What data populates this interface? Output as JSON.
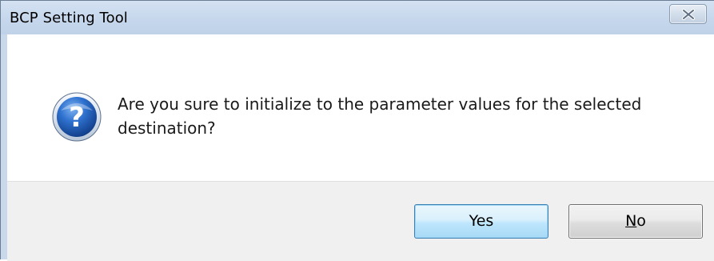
{
  "window": {
    "title": "BCP Setting Tool"
  },
  "titlebar": {
    "close_icon": "close-icon"
  },
  "dialog": {
    "icon": "question-icon",
    "message": "Are you sure to initialize to the parameter values for the selected destination?"
  },
  "buttons": {
    "yes_label": "Yes",
    "no_mnemonic": "N",
    "no_rest": "o"
  },
  "colors": {
    "titlebar": "#c6d7ec",
    "default_button_border": "#3c7fb1",
    "icon_blue": "#1f5fb8"
  }
}
